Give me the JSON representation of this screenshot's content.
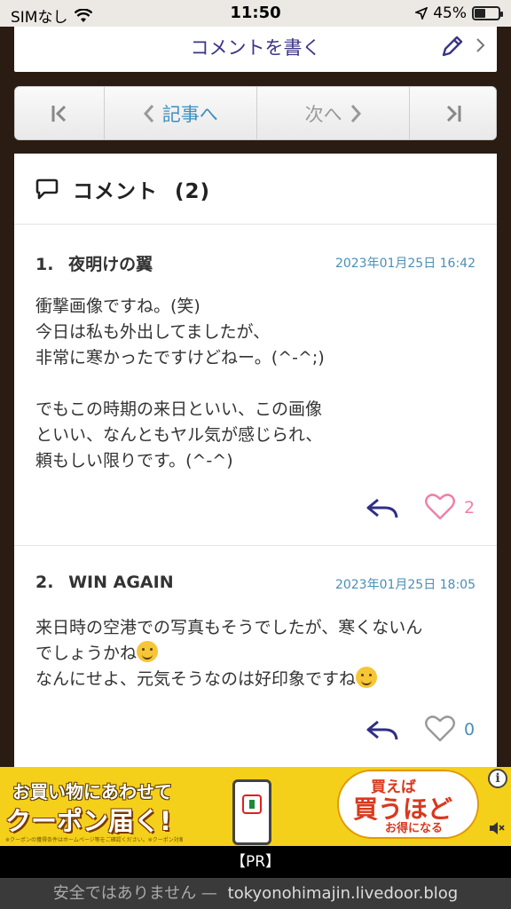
{
  "status_bar": {
    "carrier": "SIMなし",
    "time": "11:50",
    "battery": "45%",
    "battery_level": 0.45
  },
  "write_comment": {
    "label": "コメントを書く"
  },
  "pager": {
    "prev_label": "記事へ",
    "next_label": "次へ"
  },
  "comments_section": {
    "title": "コメント",
    "count": "(2)"
  },
  "comments": [
    {
      "number": "1.",
      "name": "夜明けの翼",
      "date": "2023年01月25日 16:42",
      "body": "衝撃画像ですね。(笑)\n今日は私も外出してましたが、\n非常に寒かったですけどねー。(^-^;)\n\nでもこの時期の来日といい、この画像\nといい、なんともヤル気が感じられ、\n頼もしい限りです。(^-^)",
      "likes": "2",
      "liked": true
    },
    {
      "number": "2.",
      "name": "WIN AGAIN",
      "date": "2023年01月25日 18:05",
      "body_line1": "来日時の空港での写真もそうでしたが、寒くないん",
      "body_line2": "でしょうかね",
      "body_line3": "なんにせよ、元気そうなのは好印象ですね",
      "likes": "0",
      "liked": false
    }
  ],
  "ad": {
    "line1": "お買い物にあわせて",
    "line2": "クーポン届く!",
    "fine_print": "※クーポンの獲得条件はホームページ等をご確認ください。※クーポン対象商品は一部です。",
    "badge_line1": "買えば",
    "badge_line2": "買うほど",
    "badge_line3": "お得になる",
    "info": "i"
  },
  "pr_label": "【PR】",
  "url_bar": {
    "warning": "安全ではありません —",
    "domain": "tokyonohimajin.livedoor.blog"
  },
  "colors": {
    "page_background": "#2a1c12",
    "accent_link": "#3d8fbf",
    "title_text": "#3a3585",
    "like_active": "#f07fa8",
    "date_text": "#4a8fb5"
  }
}
